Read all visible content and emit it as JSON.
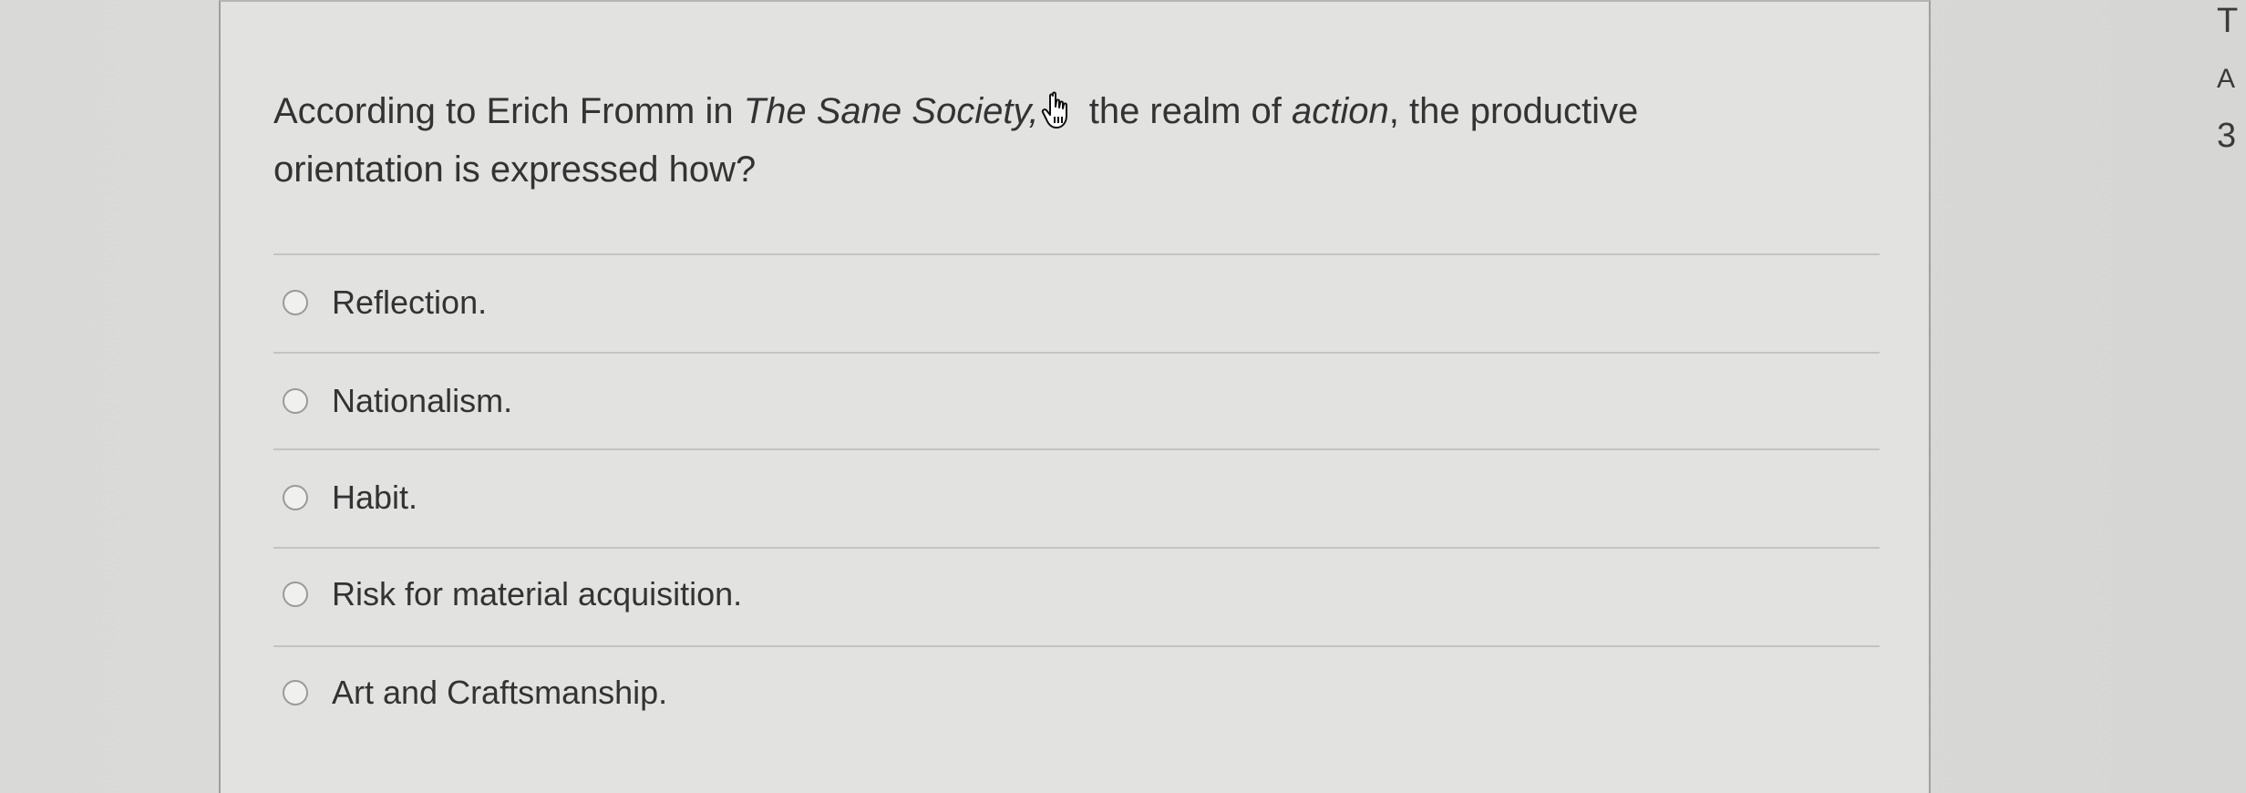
{
  "question": {
    "part1": "According to Erich Fromm in ",
    "book_title": "The Sane Society,",
    "part2": " the realm of ",
    "emphasis": "action",
    "part3": ", the productive orientation is expressed how?",
    "cursor_icon": "hand-pointer-icon"
  },
  "options": [
    {
      "label": "Reflection."
    },
    {
      "label": "Nationalism."
    },
    {
      "label": "Habit."
    },
    {
      "label": "Risk for material acquisition."
    },
    {
      "label": "Art and Craftsmanship."
    }
  ],
  "side_panel": {
    "line1": "T",
    "line2": "A",
    "line3": "3"
  }
}
